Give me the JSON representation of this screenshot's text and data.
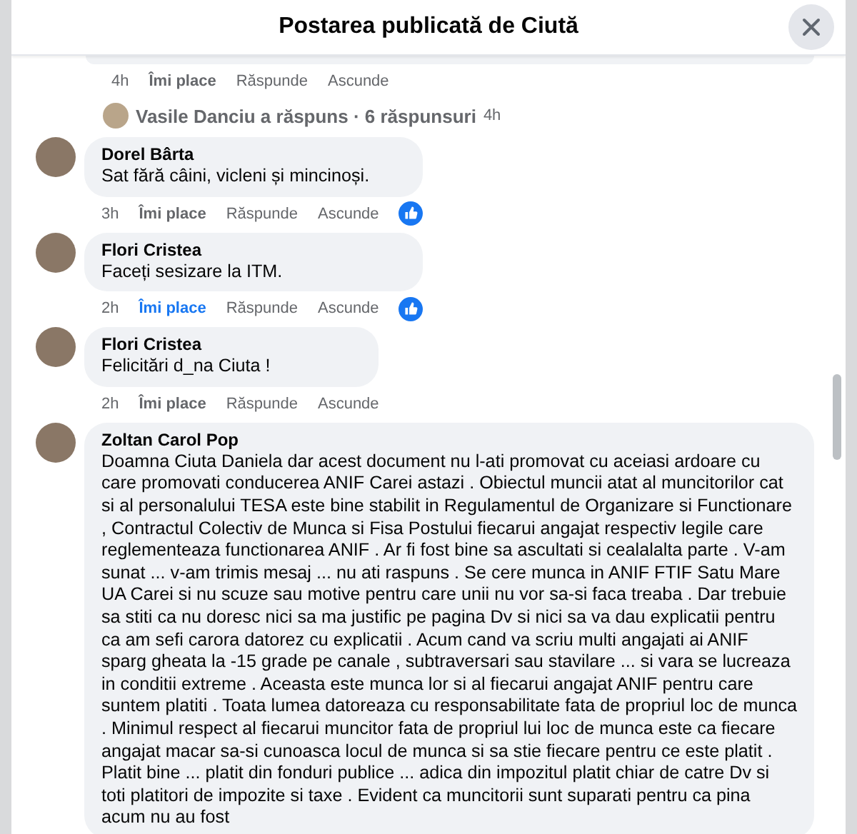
{
  "dialog": {
    "title": "Postarea publicată de Ciută"
  },
  "previous_comment": {
    "time": "4h",
    "like_label": "Îmi place",
    "reply_label": "Răspunde",
    "hide_label": "Ascunde",
    "liked": false,
    "reaction": false
  },
  "replies_summary": {
    "text": "Vasile Danciu a răspuns · 6 răspunsuri",
    "time": "4h"
  },
  "comments": [
    {
      "author": "Dorel Bârta",
      "text": "Sat fără câini, vicleni și mincinoși.",
      "actions": {
        "time": "3h",
        "like_label": "Îmi place",
        "reply_label": "Răspunde",
        "hide_label": "Ascunde",
        "liked": false,
        "reaction": true
      }
    },
    {
      "author": "Flori Cristea",
      "text": "Faceți sesizare la ITM.",
      "actions": {
        "time": "2h",
        "like_label": "Îmi place",
        "reply_label": "Răspunde",
        "hide_label": "Ascunde",
        "liked": true,
        "reaction": true
      }
    },
    {
      "author": "Flori Cristea",
      "text": "Felicitări d_na Ciuta !",
      "actions": {
        "time": "2h",
        "like_label": "Îmi place",
        "reply_label": "Răspunde",
        "hide_label": "Ascunde",
        "liked": false,
        "reaction": false
      }
    },
    {
      "author": "Zoltan Carol Pop",
      "text": "Doamna Ciuta Daniela dar acest document nu l-ati promovat cu aceiasi ardoare cu care promovati conducerea ANIF Carei astazi . Obiectul muncii atat al muncitorilor cat si al personalului TESA este bine stabilit in Regulamentul de Organizare si Functionare , Contractul Colectiv de Munca si Fisa Postului fiecarui angajat respectiv legile care reglementeaza functionarea ANIF . Ar fi fost bine sa ascultati si cealalalta parte . V-am sunat ... v-am trimis mesaj ... nu ati raspuns . Se cere munca in ANIF FTIF Satu Mare UA Carei si nu scuze sau motive pentru care unii nu vor sa-si faca treaba . Dar trebuie sa stiti ca nu doresc nici sa ma justific pe pagina Dv si nici sa va dau explicatii pentru ca am sefi carora datorez cu explicatii . Acum cand va scriu multi angajati ai ANIF sparg gheata la -15 grade pe canale , subtraversari sau stavilare ... si vara se lucreaza in conditii extreme . Aceasta este munca lor si al fiecarui angajat ANIF pentru care suntem platiti . Toata lumea datoreaza cu responsabilitate fata de propriul loc de munca . Minimul respect al fiecarui muncitor fata de propriul lui loc de munca este ca fiecare angajat macar sa-si cunoasca locul de munca si sa stie fiecare pentru ce este platit . Platit bine ... platit din fonduri publice ... adica din impozitul platit chiar de catre Dv si toti platitori de impozite si taxe . Evident ca muncitorii sunt suparati pentru ca pina acum nu au fost"
    }
  ]
}
